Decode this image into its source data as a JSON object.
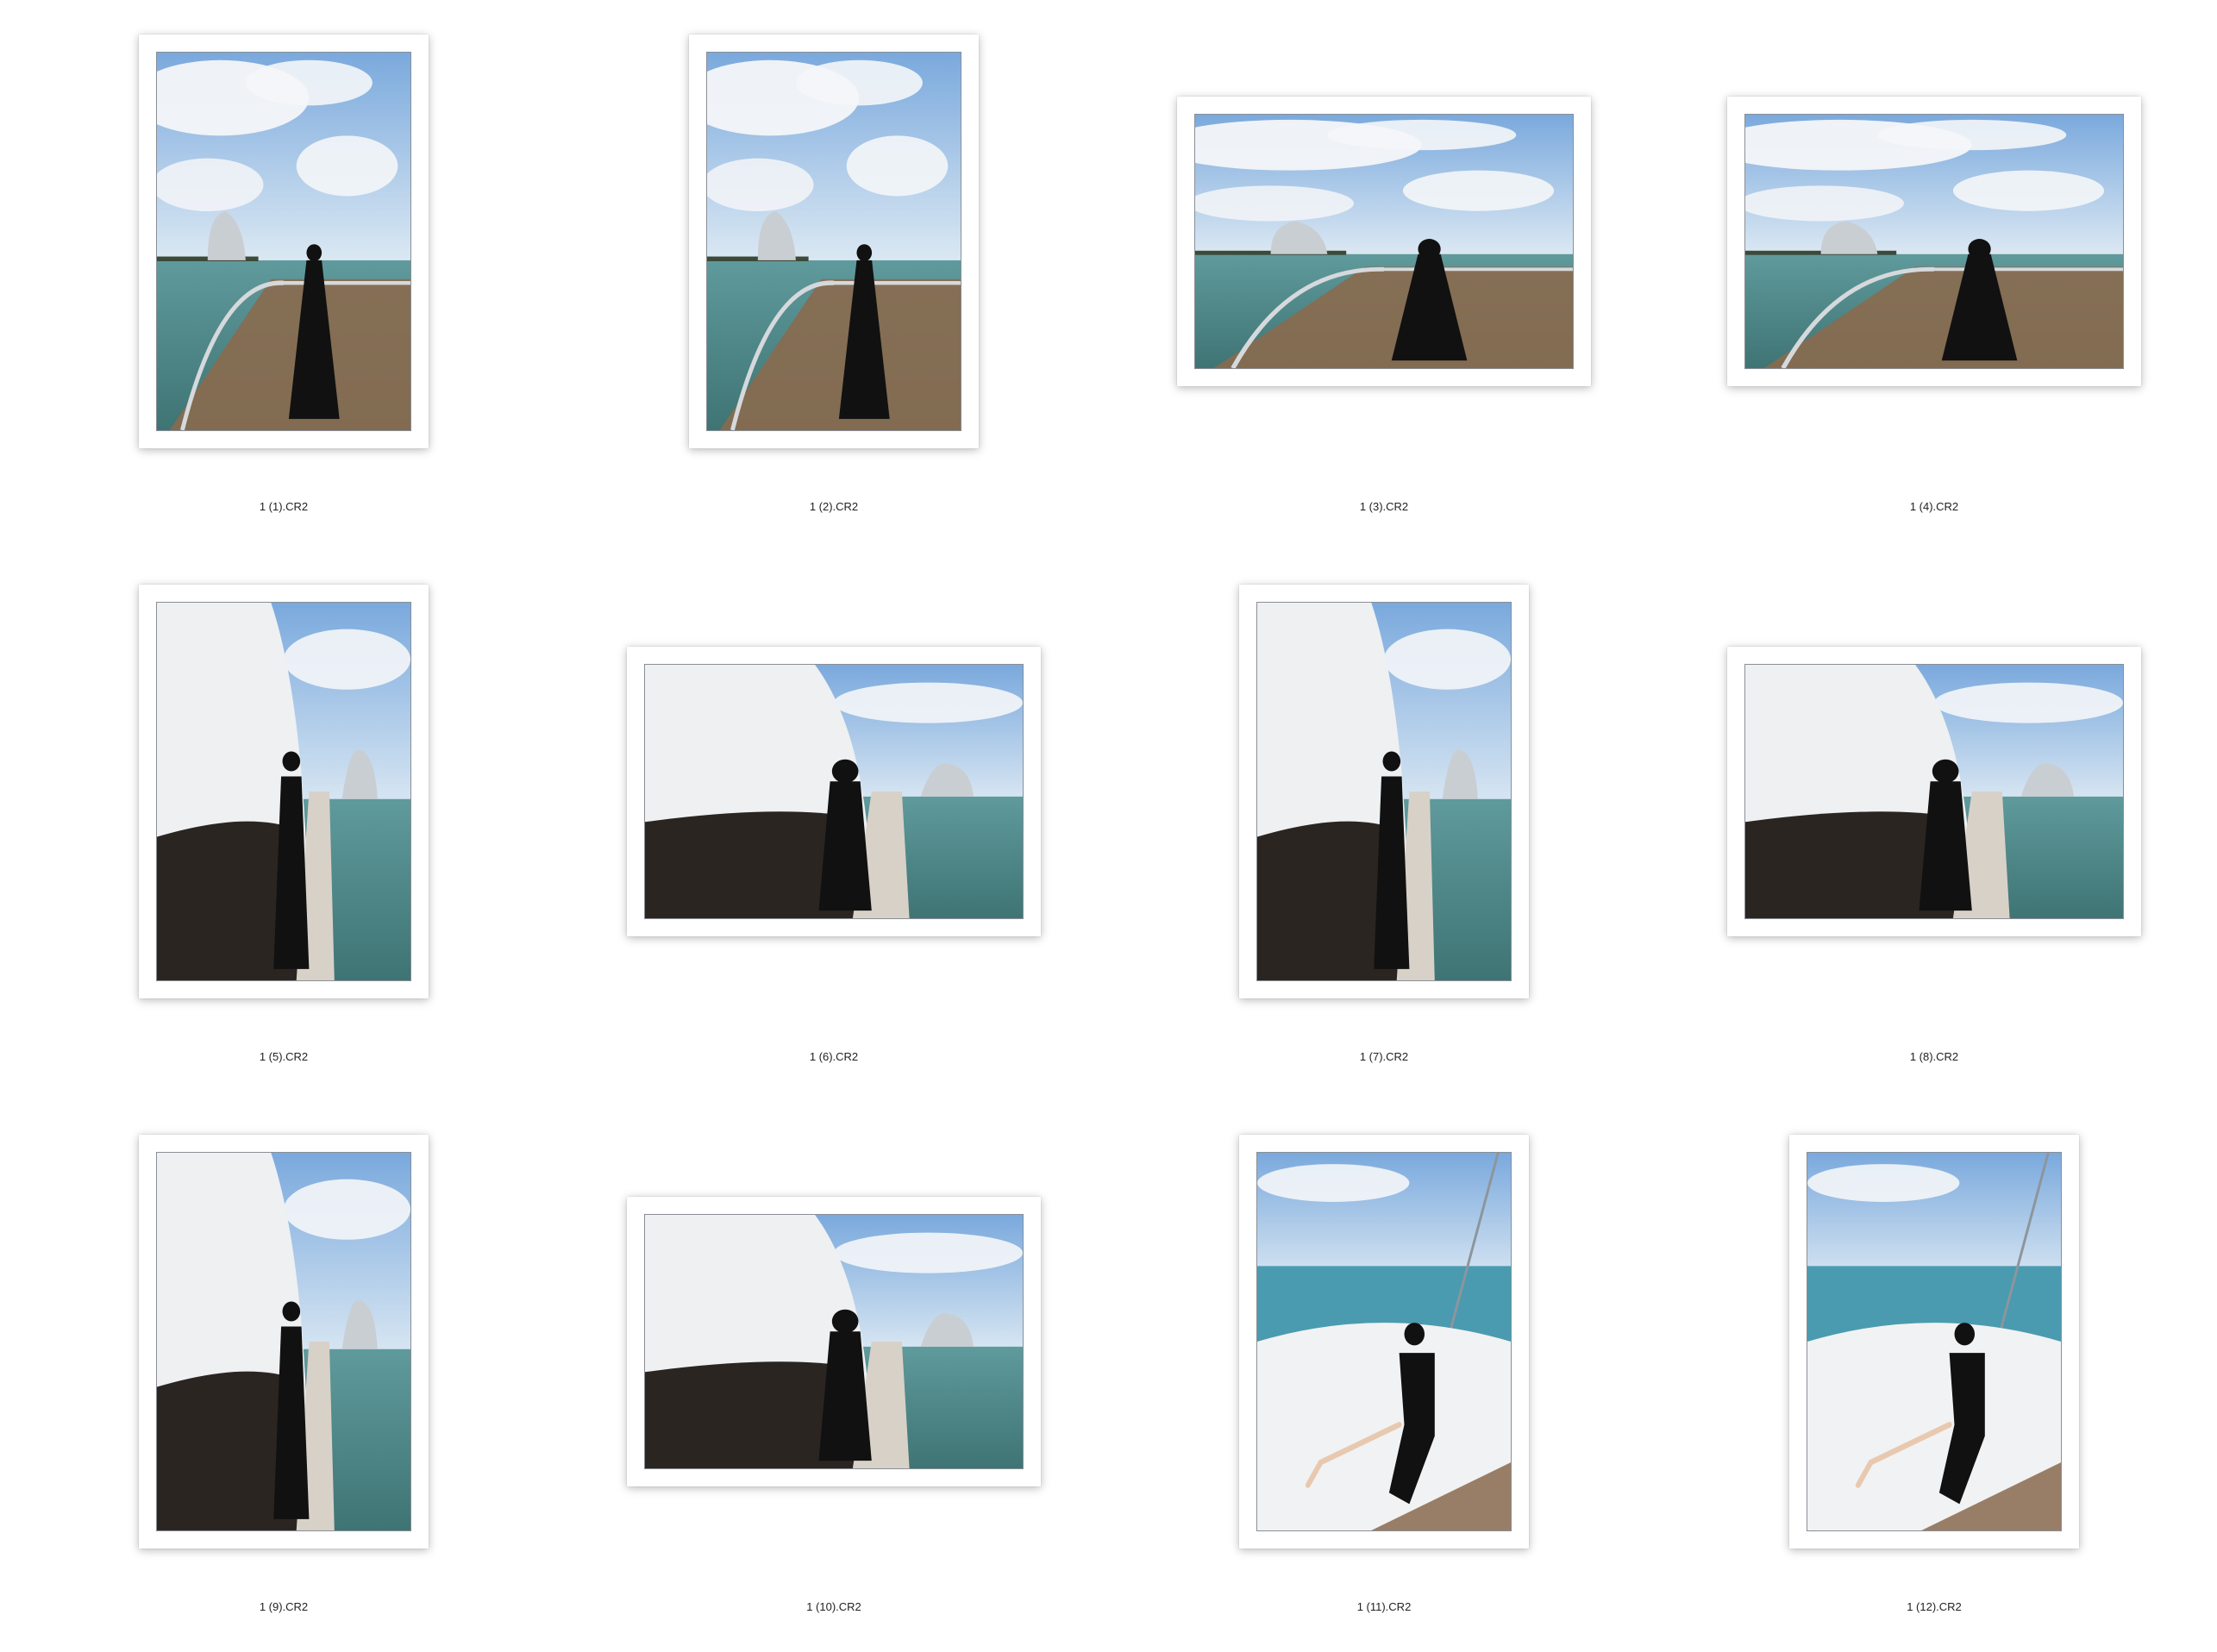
{
  "gallery": {
    "items": [
      {
        "filename": "1 (1).CR2",
        "orientation": "portrait",
        "scene": "deck-sea-tower",
        "icon": "photo-thumbnail"
      },
      {
        "filename": "1 (2).CR2",
        "orientation": "portrait",
        "scene": "deck-sea-tower",
        "icon": "photo-thumbnail"
      },
      {
        "filename": "1 (3).CR2",
        "orientation": "landscape",
        "scene": "deck-sea-tower",
        "icon": "photo-thumbnail"
      },
      {
        "filename": "1 (4).CR2",
        "orientation": "landscape",
        "scene": "deck-sea-tower",
        "icon": "photo-thumbnail"
      },
      {
        "filename": "1 (5).CR2",
        "orientation": "portrait",
        "scene": "hull-side",
        "icon": "photo-thumbnail"
      },
      {
        "filename": "1 (6).CR2",
        "orientation": "landscape",
        "scene": "hull-side",
        "icon": "photo-thumbnail"
      },
      {
        "filename": "1 (7).CR2",
        "orientation": "portrait",
        "scene": "hull-side",
        "icon": "photo-thumbnail"
      },
      {
        "filename": "1 (8).CR2",
        "orientation": "landscape",
        "scene": "hull-side",
        "icon": "photo-thumbnail"
      },
      {
        "filename": "1 (9).CR2",
        "orientation": "portrait",
        "scene": "hull-side",
        "icon": "photo-thumbnail"
      },
      {
        "filename": "1 (10).CR2",
        "orientation": "landscape",
        "scene": "hull-side",
        "icon": "photo-thumbnail"
      },
      {
        "filename": "1 (11).CR2",
        "orientation": "portrait",
        "scene": "bow-seat",
        "icon": "photo-thumbnail"
      },
      {
        "filename": "1 (12).CR2",
        "orientation": "portrait",
        "scene": "bow-seat",
        "icon": "photo-thumbnail"
      }
    ]
  },
  "colors": {
    "sky": "#8fb8e6",
    "cloud": "#f4f6f8",
    "sea": "#4f8a8a",
    "hull": "#eef0f2",
    "dress": "#111111",
    "deck": "#8a6a4e"
  }
}
